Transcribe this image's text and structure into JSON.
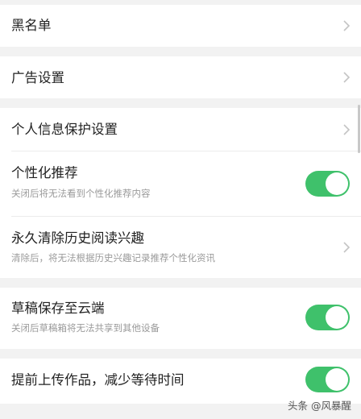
{
  "settings": {
    "blacklist": {
      "title": "黑名单"
    },
    "ad_settings": {
      "title": "广告设置"
    },
    "privacy": {
      "title": "个人信息保护设置"
    },
    "personalized": {
      "title": "个性化推荐",
      "subtitle": "关闭后将无法看到个性化推荐内容",
      "enabled": true
    },
    "clear_history": {
      "title": "永久清除历史阅读兴趣",
      "subtitle": "清除后，将无法根据历史兴趣记录推荐个性化资讯"
    },
    "draft_cloud": {
      "title": "草稿保存至云端",
      "subtitle": "关闭后草稿箱将无法共享到其他设备",
      "enabled": true
    },
    "pre_upload": {
      "title": "提前上传作品，减少等待时间",
      "enabled": true
    }
  },
  "watermark": "头条 @风暴醒",
  "colors": {
    "toggle_on": "#3fc16b",
    "background": "#f2f2f2"
  },
  "icons": {
    "chevron": "chevron-right-icon"
  }
}
